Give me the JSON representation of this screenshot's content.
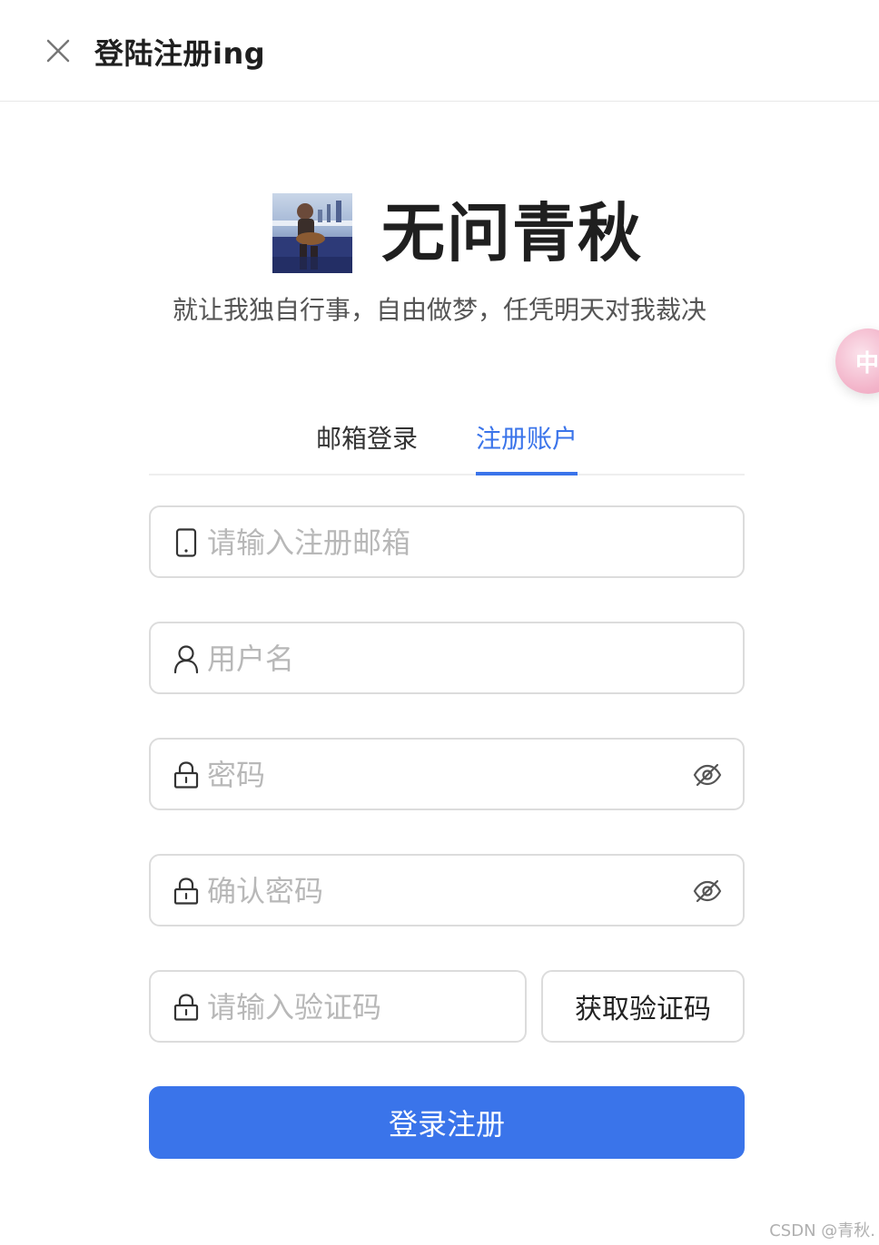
{
  "header": {
    "title": "登陆注册ing",
    "close_icon": "close-icon"
  },
  "hero": {
    "site_name": "无问青秋",
    "slogan": "就让我独自行事，自由做梦，任凭明天对我裁决"
  },
  "float_bubble": {
    "text": "中"
  },
  "tabs": [
    {
      "label": "邮箱登录",
      "active": false
    },
    {
      "label": "注册账户",
      "active": true
    }
  ],
  "form": {
    "email": {
      "placeholder": "请输入注册邮箱",
      "value": "",
      "icon": "phone-icon"
    },
    "username": {
      "placeholder": "用户名",
      "value": "",
      "icon": "user-icon"
    },
    "password": {
      "placeholder": "密码",
      "value": "",
      "icon": "lock-icon",
      "toggle_icon": "eye-off-icon"
    },
    "confirm_password": {
      "placeholder": "确认密码",
      "value": "",
      "icon": "lock-icon",
      "toggle_icon": "eye-off-icon"
    },
    "code": {
      "placeholder": "请输入验证码",
      "value": "",
      "icon": "lock-icon"
    },
    "get_code_label": "获取验证码",
    "submit_label": "登录注册"
  },
  "colors": {
    "accent": "#3a74ea",
    "border": "#dcdcdc",
    "placeholder": "#b8b8b8"
  },
  "watermark": "CSDN @青秋."
}
